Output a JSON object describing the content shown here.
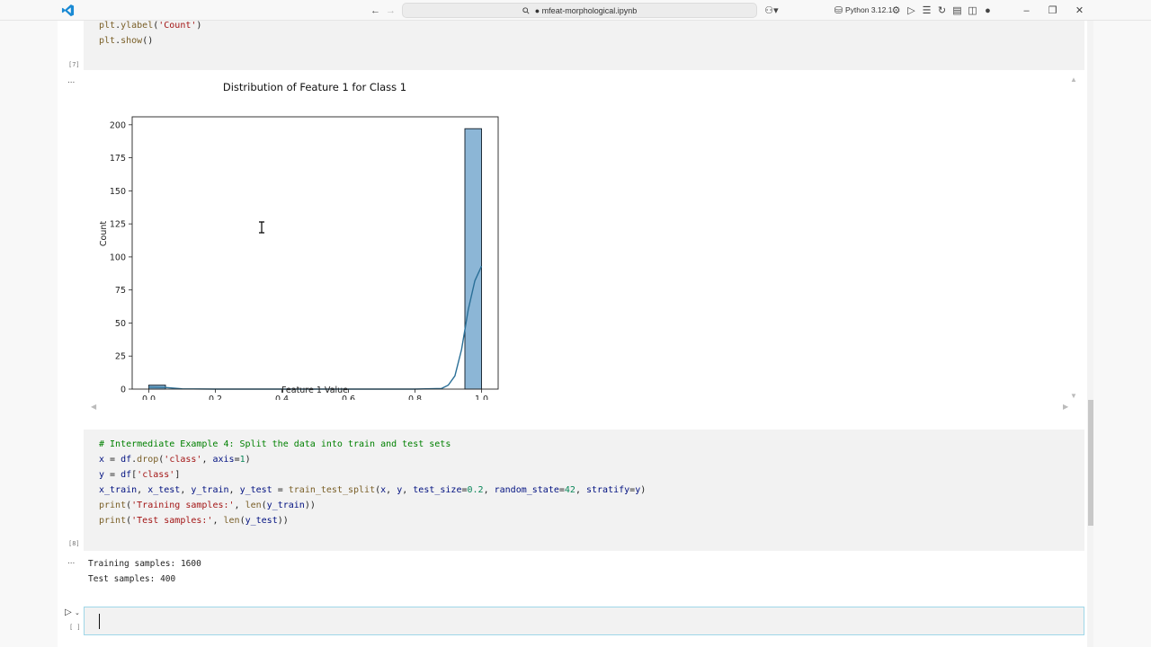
{
  "titlebar": {
    "search_text": "● mfeat-morphological.ipynb",
    "kernel": "Python 3.12.1"
  },
  "cells": {
    "cell7": {
      "lines": [
        "plt.ylabel('Count')",
        "plt.show()"
      ],
      "exec_count": "[7]"
    },
    "cell8": {
      "exec_count": "[8]",
      "comment": "# Intermediate Example 4: Split the data into train and test sets"
    },
    "output8": {
      "line1": "Training samples: 1600",
      "line2": "Test samples: 400"
    },
    "active": {
      "exec_count": "[ ]"
    }
  },
  "ellipsis": "...",
  "chart_data": {
    "type": "bar",
    "title": "Distribution of Feature 1 for Class 1",
    "xlabel": "Feature 1 Value",
    "ylabel": "Count",
    "xlim": [
      -0.05,
      1.05
    ],
    "ylim": [
      0,
      206
    ],
    "xticks": [
      "0.0",
      "0.2",
      "0.4",
      "0.6",
      "0.8",
      "1.0"
    ],
    "yticks": [
      "0",
      "25",
      "50",
      "75",
      "100",
      "125",
      "150",
      "175",
      "200"
    ],
    "bins": [
      {
        "x0": 0.0,
        "x1": 0.05,
        "count": 3
      },
      {
        "x0": 0.05,
        "x1": 0.1,
        "count": 0
      },
      {
        "x0": 0.95,
        "x1": 1.0,
        "count": 197
      }
    ],
    "kde": [
      [
        0.0,
        1.5
      ],
      [
        0.05,
        1.2
      ],
      [
        0.1,
        0.2
      ],
      [
        0.2,
        0.0
      ],
      [
        0.8,
        0.0
      ],
      [
        0.88,
        0.5
      ],
      [
        0.9,
        3
      ],
      [
        0.92,
        10
      ],
      [
        0.94,
        30
      ],
      [
        0.96,
        60
      ],
      [
        0.98,
        82
      ],
      [
        1.0,
        93
      ]
    ],
    "bar_color": "#8cb6d6",
    "line_color": "#2a6f97"
  }
}
